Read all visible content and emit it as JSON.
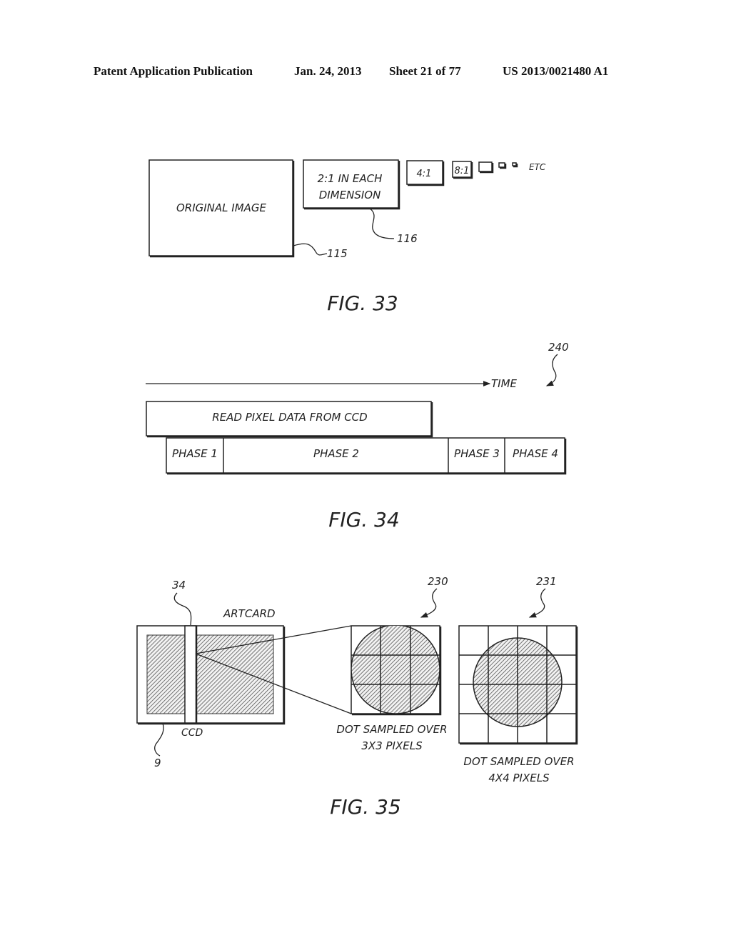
{
  "header": {
    "publication": "Patent Application Publication",
    "date": "Jan. 24, 2013",
    "sheet": "Sheet 21 of 77",
    "number": "US 2013/0021480 A1"
  },
  "fig33": {
    "caption": "FIG. 33",
    "original_image_label": "ORIGINAL IMAGE",
    "half_label_line1": "2:1 IN EACH",
    "half_label_line2": "DIMENSION",
    "quarter_label": "4:1",
    "eighth_label": "8:1",
    "etc_label": "ETC",
    "ref_original": "115",
    "ref_half": "116"
  },
  "fig34": {
    "caption": "FIG. 34",
    "time_label": "TIME",
    "ref": "240",
    "read_label": "READ PIXEL DATA FROM CCD",
    "phases": [
      "PHASE 1",
      "PHASE 2",
      "PHASE 3",
      "PHASE 4"
    ]
  },
  "fig35": {
    "caption": "FIG. 35",
    "artcard_label": "ARTCARD",
    "ccd_label": "CCD",
    "ref_ccd": "34",
    "ref_card": "9",
    "ref_3x3": "230",
    "ref_4x4": "231",
    "sample3_line1": "DOT SAMPLED OVER",
    "sample3_line2": "3X3 PIXELS",
    "sample4_line1": "DOT SAMPLED OVER",
    "sample4_line2": "4X4 PIXELS"
  }
}
